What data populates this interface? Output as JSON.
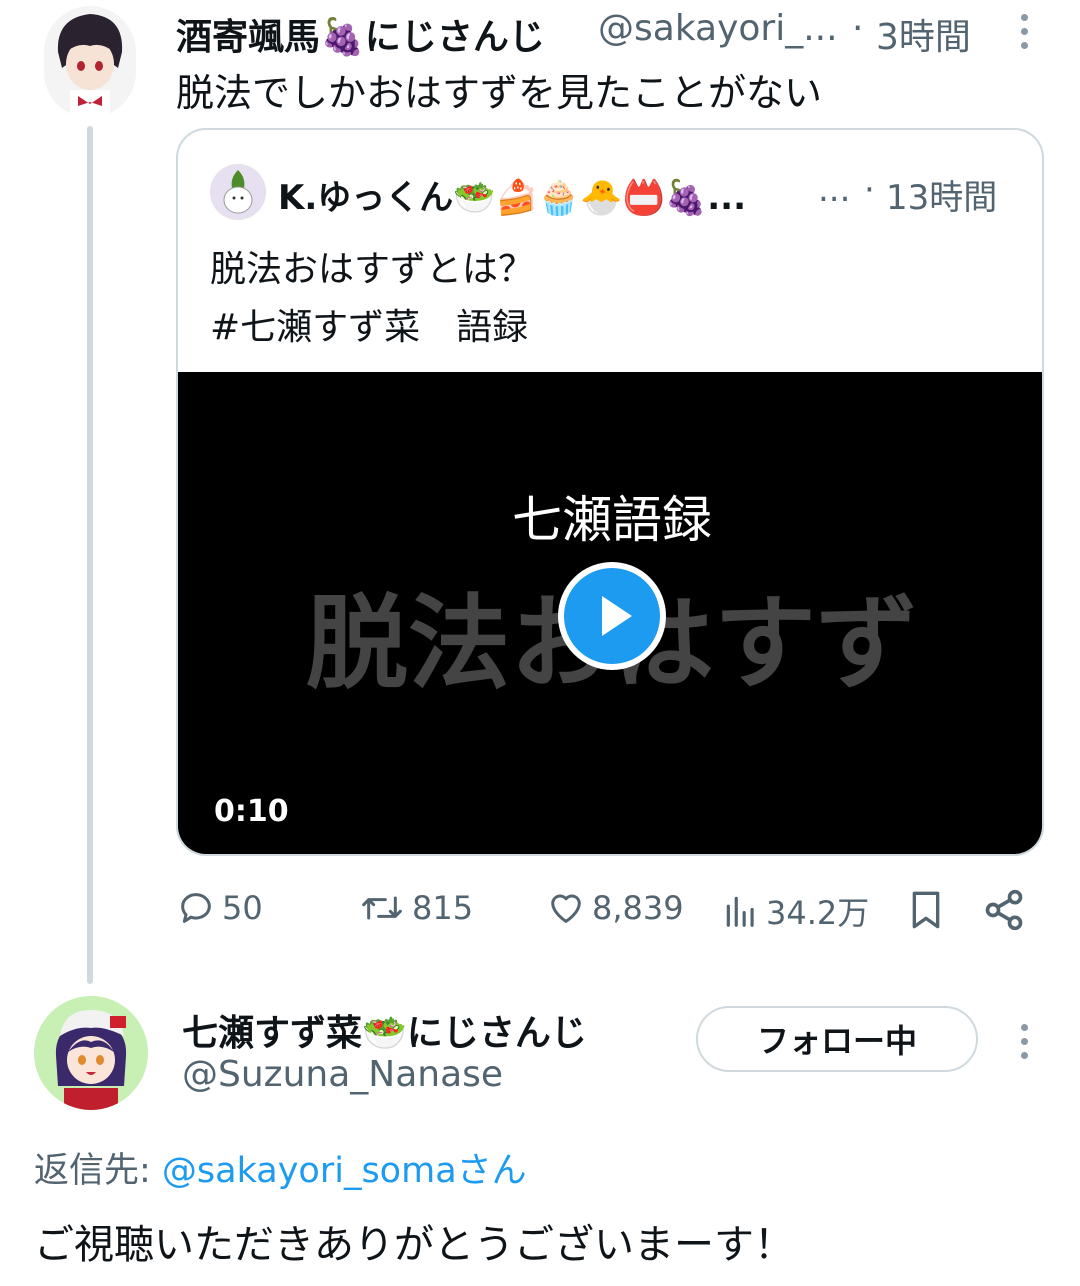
{
  "top_tweet": {
    "display_name": "酒寄颯馬🍇にじさんじ",
    "handle": "@sakayori_...",
    "separator": "·",
    "time": "3時間",
    "text": "脱法でしかおはすずを見たことがない"
  },
  "quote": {
    "display_name": "K.ゆっくん🥗🍰🧁🐣📛🍇...",
    "ellipsis": "...",
    "separator": "·",
    "time": "13時間",
    "text_line1": "脱法おはすずとは？",
    "text_line2": "#七瀬すず菜　語録",
    "video": {
      "title": "七瀬語録",
      "subtitle": "脱法おはすず",
      "duration": "0:10"
    }
  },
  "actions": {
    "replies": "50",
    "retweets": "815",
    "likes": "8,839",
    "views": "34.2万"
  },
  "reply_tweet": {
    "display_name": "七瀬すず菜🥗にじさんじ",
    "handle": "@Suzuna_Nanase",
    "follow_label": "フォロー中",
    "reply_prefix": "返信先: ",
    "reply_target": "@sakayori_somaさん",
    "text": "ご視聴いただきありがとうございまーす！"
  },
  "colors": {
    "accent": "#1d9bf0",
    "secondary_text": "#536471",
    "border": "#cfd9de"
  }
}
